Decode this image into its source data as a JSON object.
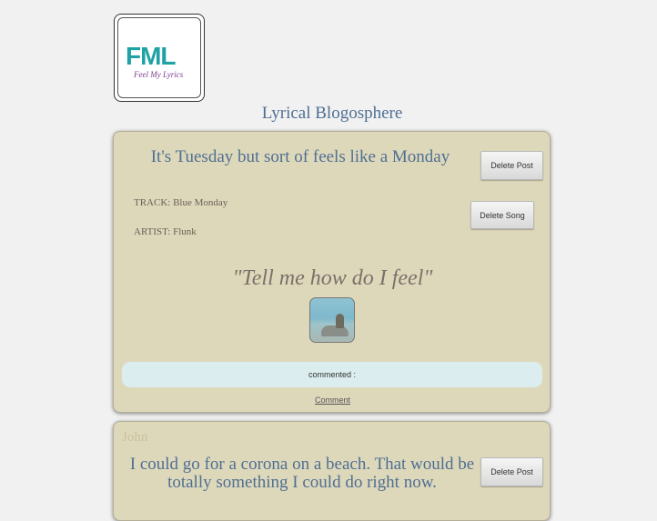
{
  "logo": {
    "main_text": "FML",
    "sub_text": "Feel My Lyrics"
  },
  "site_title": "Lyrical Blogosphere",
  "posts": [
    {
      "title": "It's Tuesday but sort of feels like a Monday",
      "delete_post_label": "Delete Post",
      "delete_song_label": "Delete Song",
      "track": "TRACK: Blue Monday",
      "artist": "ARTIST: Flunk",
      "lyric": "\"Tell me how do I feel\"",
      "comments_text": "commented :",
      "comment_link": "Comment"
    },
    {
      "author": "John",
      "title": "I could go for a corona on a beach. That would be totally something I could do right now.",
      "delete_post_label": "Delete Post"
    }
  ]
}
